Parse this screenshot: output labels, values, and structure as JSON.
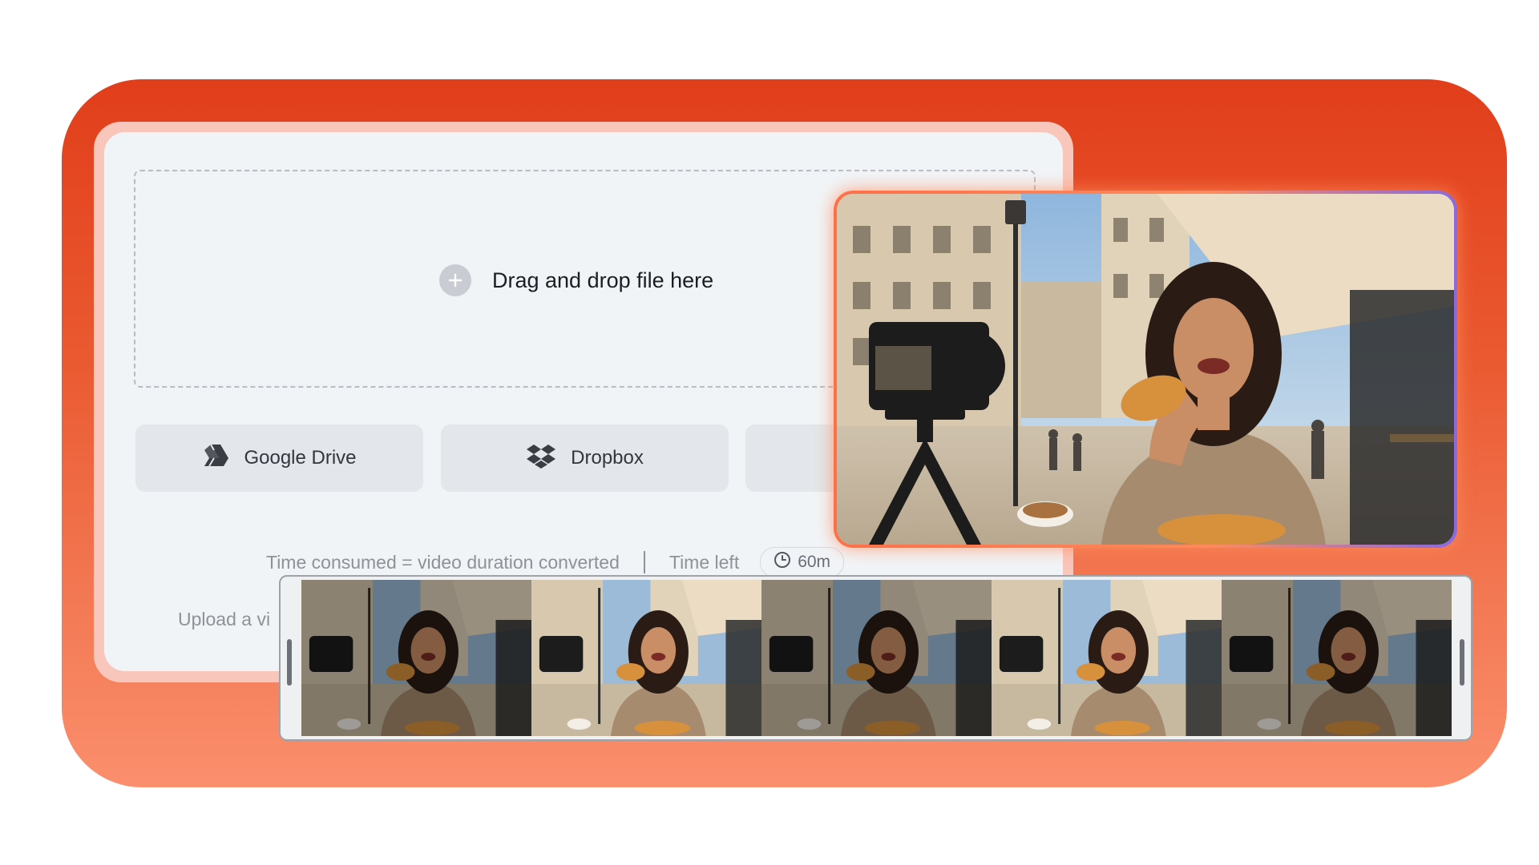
{
  "dropzone": {
    "label": "Drag and drop file here"
  },
  "cloud_buttons": {
    "google_drive": "Google Drive",
    "dropbox": "Dropbox"
  },
  "info": {
    "time_consumed": "Time consumed = video duration converted",
    "time_left_label": "Time left",
    "time_left_value": "60m"
  },
  "upload_hint": "Upload a vi",
  "colors": {
    "accent": "#e13e1b",
    "accent_light": "#fb8f6d",
    "panel": "#f1f4f7",
    "button": "#e3e6ea"
  },
  "icons": {
    "dropzone": "plus-circle-icon",
    "google_drive": "google-drive-icon",
    "dropbox": "dropbox-icon",
    "time_left": "clock-icon"
  },
  "timeline": {
    "frames": [
      {
        "dimmed": true
      },
      {
        "dimmed": false
      },
      {
        "dimmed": true
      },
      {
        "dimmed": false
      },
      {
        "dimmed": true
      }
    ]
  }
}
